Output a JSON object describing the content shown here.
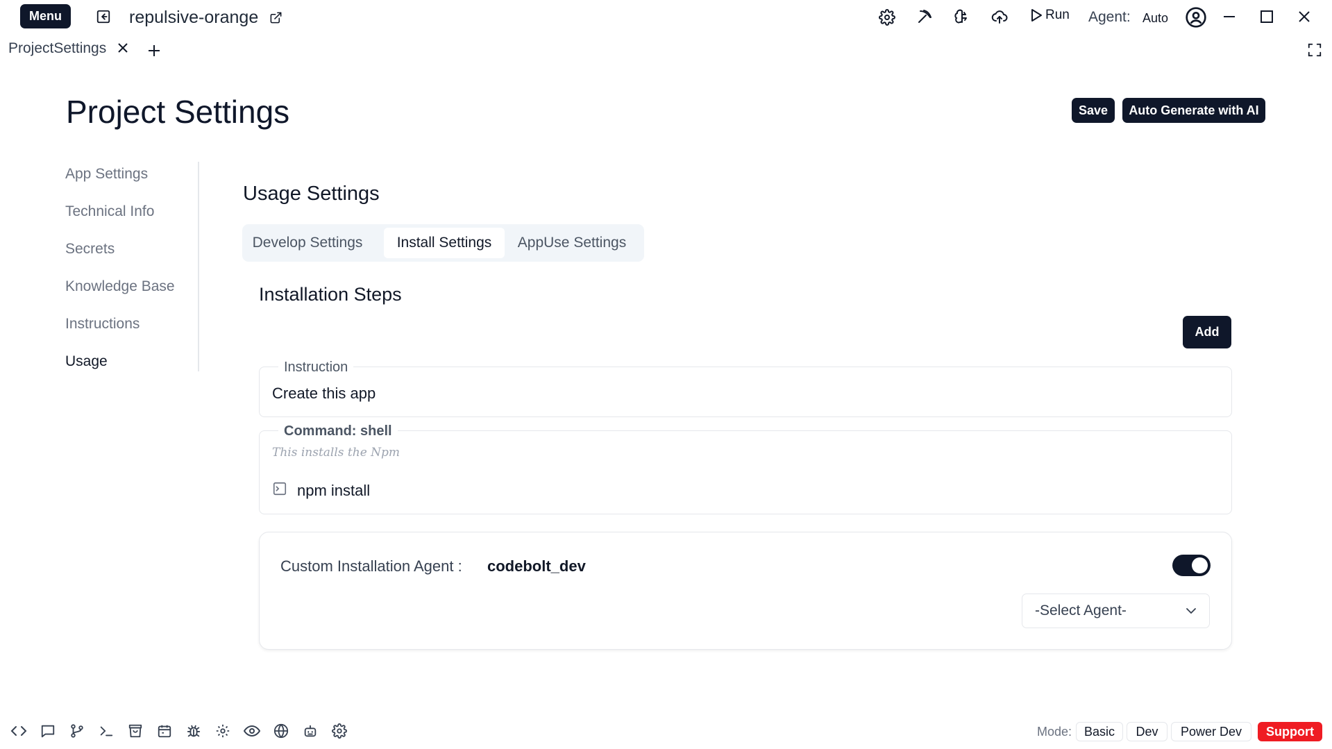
{
  "topbar": {
    "menu_label": "Menu",
    "project_name": "repulsive-orange",
    "run_label": "Run",
    "agent_label": "Agent:",
    "agent_value": "Auto",
    "icons": [
      "back-arrow-icon",
      "external-link-icon",
      "gear-icon",
      "pickaxe-icon",
      "brain-icon",
      "cloud-upload-icon",
      "play-icon",
      "user-circle-icon",
      "minimize-icon",
      "maximize-icon",
      "close-icon"
    ]
  },
  "tabbar": {
    "tab_label": "ProjectSettings"
  },
  "header": {
    "title": "Project Settings",
    "save_label": "Save",
    "autogen_label": "Auto Generate with AI"
  },
  "sidebar": {
    "items": [
      {
        "label": "App Settings"
      },
      {
        "label": "Technical Info"
      },
      {
        "label": "Secrets"
      },
      {
        "label": "Knowledge Base"
      },
      {
        "label": "Instructions"
      },
      {
        "label": "Usage"
      }
    ],
    "active": "Usage"
  },
  "main": {
    "section_title": "Usage Settings",
    "tabs": [
      {
        "label": "Develop Settings"
      },
      {
        "label": "Install Settings"
      },
      {
        "label": "AppUse Settings"
      }
    ],
    "active_tab": "Install Settings",
    "steps_title": "Installation Steps",
    "add_label": "Add",
    "instruction": {
      "legend": "Instruction",
      "value": "Create this app"
    },
    "command": {
      "legend": "Command: shell",
      "description": "This installs the Npm",
      "value": "npm install"
    },
    "agent_card": {
      "label": "Custom Installation Agent :",
      "agent_name": "codebolt_dev",
      "toggle_on": true,
      "select_placeholder": "-Select Agent-"
    }
  },
  "bottombar": {
    "icons": [
      "code-icon",
      "chat-icon",
      "git-branch-icon",
      "terminal-icon",
      "shopping-bag-icon",
      "calendar-icon",
      "bug-icon",
      "gear-icon",
      "eye-icon",
      "globe-icon",
      "robot-icon",
      "settings-icon"
    ],
    "mode_label": "Mode:",
    "modes": [
      {
        "label": "Basic"
      },
      {
        "label": "Dev"
      },
      {
        "label": "Power Dev"
      }
    ],
    "support_label": "Support"
  },
  "colors": {
    "dark": "#0f172a",
    "support": "#ef1c23",
    "tabs_bg": "#f1f5f9"
  }
}
